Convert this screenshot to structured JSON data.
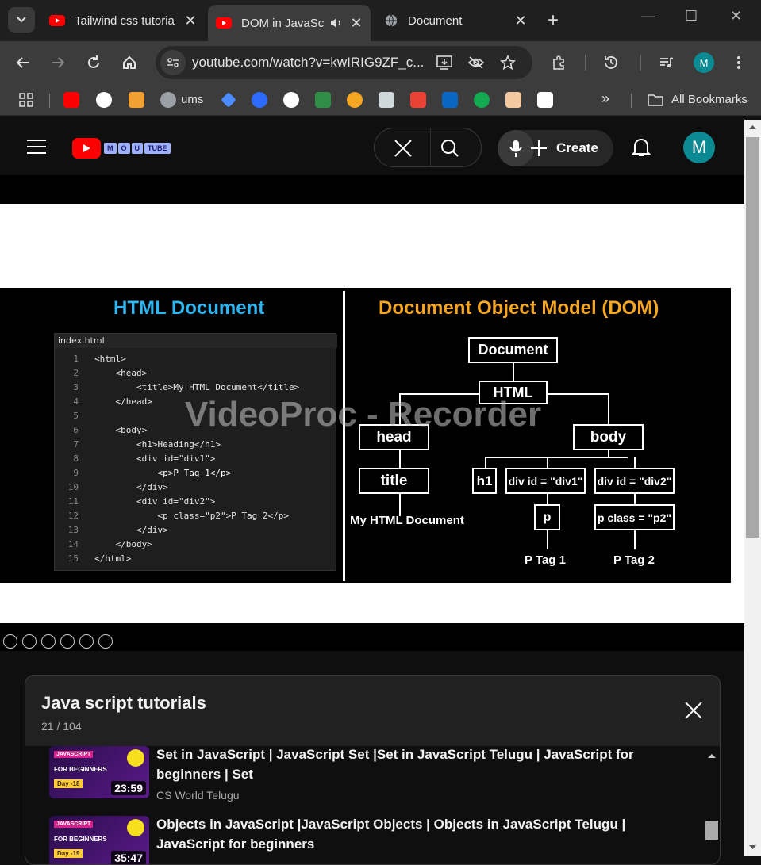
{
  "browser": {
    "tabs": [
      {
        "title": "Tailwind css tutoria",
        "active": false
      },
      {
        "title": "DOM in JavaSc",
        "active": true
      },
      {
        "title": "Document",
        "active": false
      }
    ],
    "url": "youtube.com/watch?v=kwIRIG9ZF_c...",
    "profile_initial": "M",
    "bookmarks": [
      {
        "label": "ums"
      },
      {
        "label": "All Bookmarks"
      }
    ]
  },
  "youtube": {
    "logo_letters": [
      "M",
      "O",
      "U",
      "TUBE"
    ],
    "create_label": "Create",
    "avatar_initial": "M"
  },
  "video": {
    "left_title": "HTML Document",
    "right_title": "Document Object Model (DOM)",
    "code_file": "index.html",
    "code_lines": [
      {
        "n": "1",
        "t": "<html>"
      },
      {
        "n": "2",
        "t": "    <head>"
      },
      {
        "n": "3",
        "t": "        <title>My HTML Document</title>"
      },
      {
        "n": "4",
        "t": "    </head>"
      },
      {
        "n": "5",
        "t": ""
      },
      {
        "n": "6",
        "t": "    <body>"
      },
      {
        "n": "7",
        "t": "        <h1>Heading</h1>"
      },
      {
        "n": "8",
        "t": "        <div id=\"div1\">"
      },
      {
        "n": "9",
        "t": "            <p>P Tag 1</p>"
      },
      {
        "n": "10",
        "t": "        </div>"
      },
      {
        "n": "11",
        "t": "        <div id=\"div2\">"
      },
      {
        "n": "12",
        "t": "            <p class=\"p2\">P Tag 2</p>"
      },
      {
        "n": "13",
        "t": "        </div>"
      },
      {
        "n": "14",
        "t": "    </body>"
      },
      {
        "n": "15",
        "t": "</html>"
      }
    ],
    "dom": {
      "document": "Document",
      "html": "HTML",
      "head": "head",
      "body": "body",
      "title": "title",
      "title_text": "My HTML Document",
      "h1": "h1",
      "div1": "div id = \"div1\"",
      "div2": "div id = \"div2\"",
      "p": "p",
      "p2": "p class = \"p2\"",
      "ptag1": "P Tag 1",
      "ptag2": "P Tag 2"
    },
    "watermark": "VideoProc - Recorder"
  },
  "playlist": {
    "title": "Java script tutorials",
    "position": "21 / 104",
    "items": [
      {
        "title": "Set in JavaScript | JavaScript Set |Set in JavaScript Telugu | JavaScript for beginners | Set",
        "channel": "CS World Telugu",
        "duration": "23:59",
        "thumb_tag": "JAVASCRIPT",
        "thumb_sub": "FOR BEGINNERS",
        "thumb_day": "Day -18"
      },
      {
        "title": "Objects in JavaScript |JavaScript Objects | Objects in JavaScript Telugu | JavaScript for beginners",
        "channel": "",
        "duration": "35:47",
        "thumb_tag": "JAVASCRIPT",
        "thumb_sub": "FOR BEGINNERS",
        "thumb_day": "Day -19"
      }
    ]
  }
}
